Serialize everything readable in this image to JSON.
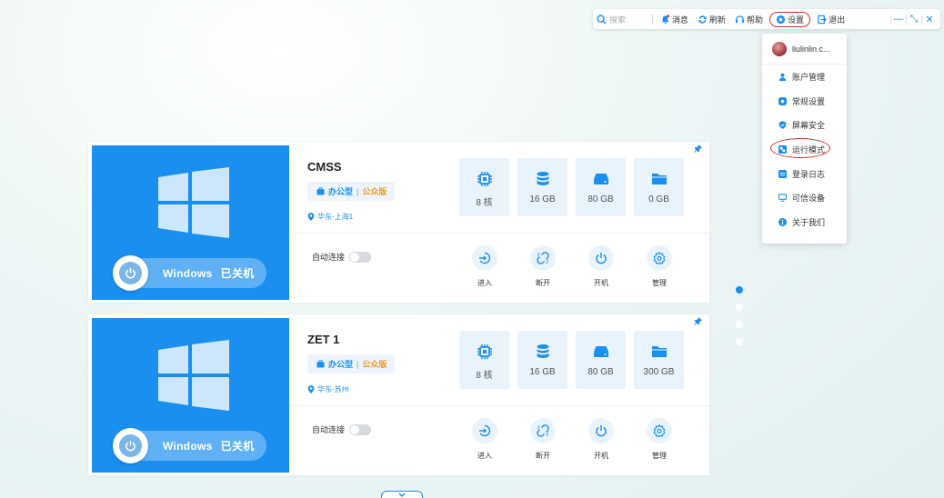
{
  "toolbar": {
    "search_placeholder": "搜索",
    "messages": "消息",
    "refresh": "刷新",
    "help": "帮助",
    "settings": "设置",
    "logout": "退出"
  },
  "dropdown": {
    "username": "liulinlin.c...",
    "items": [
      {
        "label": "账户管理"
      },
      {
        "label": "常规设置"
      },
      {
        "label": "屏幕安全"
      },
      {
        "label": "运行模式"
      },
      {
        "label": "登录日志"
      },
      {
        "label": "可信设备"
      },
      {
        "label": "关于我们"
      }
    ]
  },
  "cards": [
    {
      "os": "Windows",
      "status": "已关机",
      "name": "CMSS",
      "plan": "办公型",
      "edition": "公众版",
      "region": "华东-上海1",
      "cpu": "8 核",
      "memory": "16 GB",
      "disk": "80 GB",
      "data_disk": "0 GB",
      "auto_connect": "自动连接",
      "actions": {
        "enter": "进入",
        "disconnect": "断开",
        "power_on": "开机",
        "manage": "管理"
      }
    },
    {
      "os": "Windows",
      "status": "已关机",
      "name": "ZET 1",
      "plan": "办公型",
      "edition": "公众版",
      "region": "华东-苏州",
      "cpu": "8 核",
      "memory": "16 GB",
      "disk": "80 GB",
      "data_disk": "300 GB",
      "auto_connect": "自动连接",
      "actions": {
        "enter": "进入",
        "disconnect": "断开",
        "power_on": "开机",
        "manage": "管理"
      }
    }
  ],
  "colors": {
    "accent": "#1a8ff0",
    "edition": "#f09a20",
    "highlight": "#d0302a"
  }
}
